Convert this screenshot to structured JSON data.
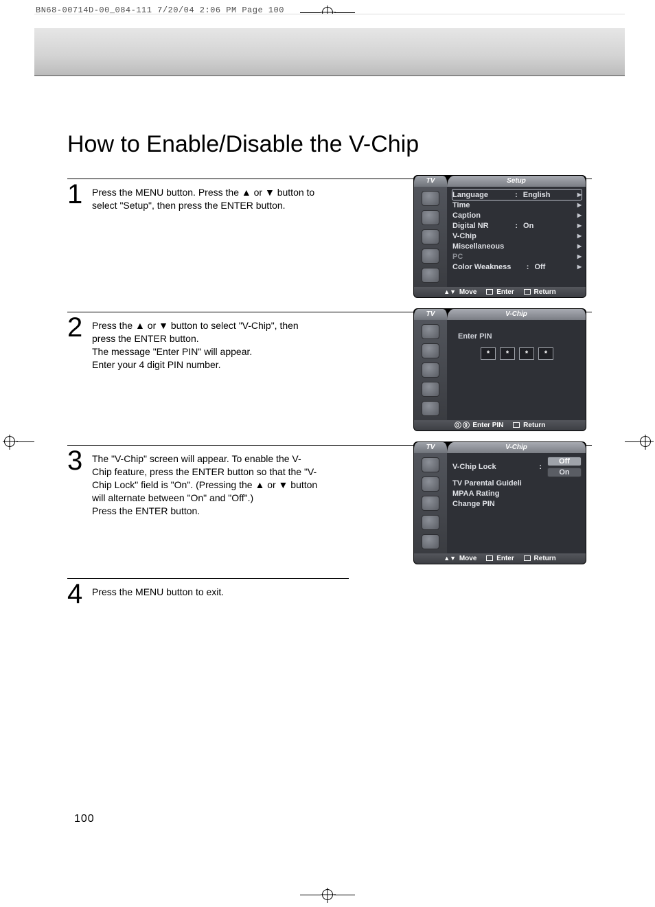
{
  "job_header": "BN68-00714D-00_084-111  7/20/04  2:06 PM  Page 100",
  "title": "How to Enable/Disable the V-Chip",
  "page_number": "100",
  "steps": {
    "s1": {
      "num": "1",
      "a": "Press the MENU button. Press the ",
      "b": " or ",
      "c": " button to select \"Setup\", then press the ENTER button."
    },
    "s2": {
      "num": "2",
      "a": "Press the ",
      "b": " or ",
      "c": " button to select \"V-Chip\", then press the ENTER button.",
      "d": "The message \"Enter PIN\" will appear.",
      "e": "Enter your 4 digit PIN number."
    },
    "s3": {
      "num": "3",
      "a": "The \"V-Chip\" screen will appear. To enable the V-Chip feature, press the ENTER button so that the \"V-Chip Lock\" field is \"On\". (Pressing the ",
      "b": " or ",
      "c": " button will alternate between \"On\" and \"Off\".)",
      "d": "Press the ENTER button."
    },
    "s4": {
      "num": "4",
      "a": "Press the MENU button to exit."
    }
  },
  "osd1": {
    "tv": "TV",
    "title": "Setup",
    "rows": {
      "language": "Language",
      "language_v": "English",
      "time": "Time",
      "caption": "Caption",
      "digitalnr": "Digital NR",
      "digitalnr_v": "On",
      "vchip": "V-Chip",
      "misc": "Miscellaneous",
      "pc": "PC",
      "cw": "Color Weakness",
      "cw_v": "Off"
    },
    "f_move": "Move",
    "f_enter": "Enter",
    "f_return": "Return"
  },
  "osd2": {
    "tv": "TV",
    "title": "V-Chip",
    "enter_pin": "Enter PIN",
    "star": "*",
    "f_enterpin": "Enter PIN",
    "f_return": "Return"
  },
  "osd3": {
    "tv": "TV",
    "title": "V-Chip",
    "rows": {
      "lock": "V-Chip Lock",
      "guide": "TV Parental Guideli",
      "mpaa": "MPAA Rating",
      "change": "Change PIN",
      "off": "Off",
      "on": "On"
    },
    "f_move": "Move",
    "f_enter": "Enter",
    "f_return": "Return"
  }
}
